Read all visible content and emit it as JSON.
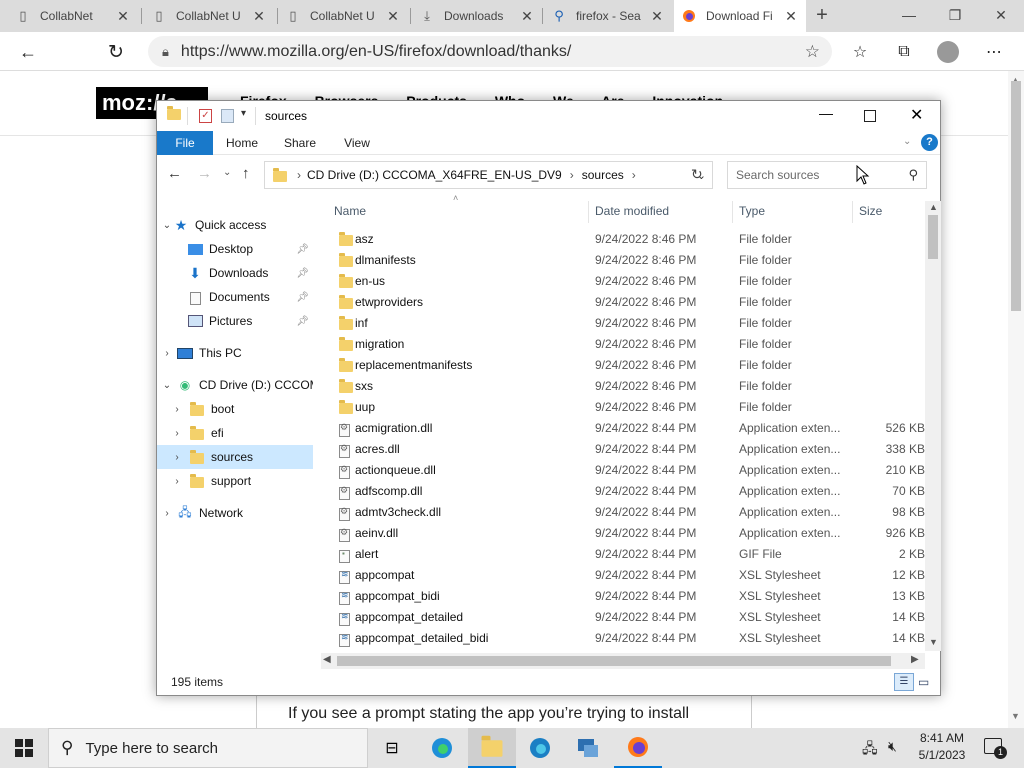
{
  "browser": {
    "tabs": [
      {
        "title": "CollabNet",
        "icon": "page-icon"
      },
      {
        "title": "CollabNet U",
        "icon": "page-icon"
      },
      {
        "title": "CollabNet U",
        "icon": "page-icon"
      },
      {
        "title": "Downloads",
        "icon": "download-icon"
      },
      {
        "title": "firefox - Sea",
        "icon": "search-icon"
      },
      {
        "title": "Download Fi",
        "icon": "firefox-icon",
        "active": true
      }
    ],
    "url": "https://www.mozilla.org/en-US/firefox/download/thanks/"
  },
  "page": {
    "logo": "moz://a",
    "nav": "Firefox Browsers Products Who We Are Innovation",
    "body_text": "If you see a prompt stating the app you’re trying to install"
  },
  "explorer": {
    "title": "sources",
    "ribbon_tabs": [
      "File",
      "Home",
      "Share",
      "View"
    ],
    "path": [
      "CD Drive (D:) CCCOMA_X64FRE_EN-US_DV9",
      "sources"
    ],
    "search_placeholder": "Search sources",
    "sidebar": {
      "quick_access": "Quick access",
      "desktop": "Desktop",
      "downloads": "Downloads",
      "documents": "Documents",
      "pictures": "Pictures",
      "this_pc": "This PC",
      "cd_drive": "CD Drive (D:) CCCOMA",
      "boot": "boot",
      "efi": "efi",
      "sources": "sources",
      "support": "support",
      "network": "Network"
    },
    "columns": {
      "name": "Name",
      "date": "Date modified",
      "type": "Type",
      "size": "Size"
    },
    "files": [
      {
        "name": "asz",
        "date": "9/24/2022 8:46 PM",
        "type": "File folder",
        "size": "",
        "kind": "folder"
      },
      {
        "name": "dlmanifests",
        "date": "9/24/2022 8:46 PM",
        "type": "File folder",
        "size": "",
        "kind": "folder"
      },
      {
        "name": "en-us",
        "date": "9/24/2022 8:46 PM",
        "type": "File folder",
        "size": "",
        "kind": "folder"
      },
      {
        "name": "etwproviders",
        "date": "9/24/2022 8:46 PM",
        "type": "File folder",
        "size": "",
        "kind": "folder"
      },
      {
        "name": "inf",
        "date": "9/24/2022 8:46 PM",
        "type": "File folder",
        "size": "",
        "kind": "folder"
      },
      {
        "name": "migration",
        "date": "9/24/2022 8:46 PM",
        "type": "File folder",
        "size": "",
        "kind": "folder"
      },
      {
        "name": "replacementmanifests",
        "date": "9/24/2022 8:46 PM",
        "type": "File folder",
        "size": "",
        "kind": "folder"
      },
      {
        "name": "sxs",
        "date": "9/24/2022 8:46 PM",
        "type": "File folder",
        "size": "",
        "kind": "folder"
      },
      {
        "name": "uup",
        "date": "9/24/2022 8:46 PM",
        "type": "File folder",
        "size": "",
        "kind": "folder"
      },
      {
        "name": "acmigration.dll",
        "date": "9/24/2022 8:44 PM",
        "type": "Application exten...",
        "size": "526 KB",
        "kind": "gear"
      },
      {
        "name": "acres.dll",
        "date": "9/24/2022 8:44 PM",
        "type": "Application exten...",
        "size": "338 KB",
        "kind": "gear"
      },
      {
        "name": "actionqueue.dll",
        "date": "9/24/2022 8:44 PM",
        "type": "Application exten...",
        "size": "210 KB",
        "kind": "gear"
      },
      {
        "name": "adfscomp.dll",
        "date": "9/24/2022 8:44 PM",
        "type": "Application exten...",
        "size": "70 KB",
        "kind": "gear"
      },
      {
        "name": "admtv3check.dll",
        "date": "9/24/2022 8:44 PM",
        "type": "Application exten...",
        "size": "98 KB",
        "kind": "gear"
      },
      {
        "name": "aeinv.dll",
        "date": "9/24/2022 8:44 PM",
        "type": "Application exten...",
        "size": "926 KB",
        "kind": "gear"
      },
      {
        "name": "alert",
        "date": "9/24/2022 8:44 PM",
        "type": "GIF File",
        "size": "2 KB",
        "kind": "gif"
      },
      {
        "name": "appcompat",
        "date": "9/24/2022 8:44 PM",
        "type": "XSL Stylesheet",
        "size": "12 KB",
        "kind": "xsl"
      },
      {
        "name": "appcompat_bidi",
        "date": "9/24/2022 8:44 PM",
        "type": "XSL Stylesheet",
        "size": "13 KB",
        "kind": "xsl"
      },
      {
        "name": "appcompat_detailed",
        "date": "9/24/2022 8:44 PM",
        "type": "XSL Stylesheet",
        "size": "14 KB",
        "kind": "xsl"
      },
      {
        "name": "appcompat_detailed_bidi",
        "date": "9/24/2022 8:44 PM",
        "type": "XSL Stylesheet",
        "size": "14 KB",
        "kind": "xsl"
      }
    ],
    "status": "195 items"
  },
  "taskbar": {
    "search_placeholder": "Type here to search",
    "time": "8:41 AM",
    "date": "5/1/2023",
    "notification_count": "1"
  },
  "colors": {
    "accent": "#0078d7",
    "selection": "#cce8ff",
    "folder": "#f4d16b"
  }
}
